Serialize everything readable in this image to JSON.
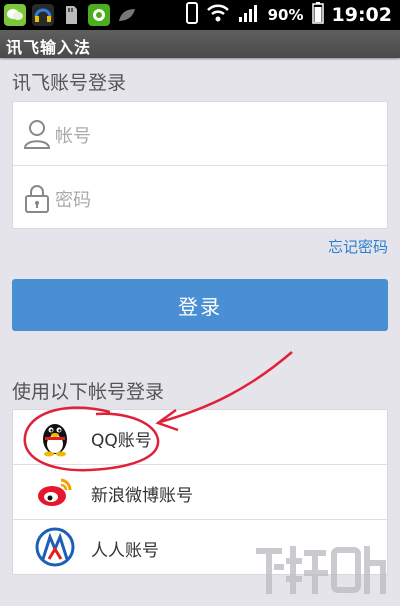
{
  "status_bar": {
    "battery_percent": "90%",
    "time": "19:02",
    "icons": [
      "wechat-icon",
      "headset-icon",
      "sd-card-icon",
      "wechat-green-icon",
      "leaf-icon",
      "phone-icon",
      "wifi-icon",
      "signal-icon",
      "battery-icon"
    ]
  },
  "app_title": "讯飞输入法",
  "login": {
    "section_title": "讯飞账号登录",
    "username_placeholder": "帐号",
    "password_placeholder": "密码",
    "forgot_password": "忘记密码",
    "login_button": "登录"
  },
  "third_party": {
    "section_title": "使用以下帐号登录",
    "options": [
      {
        "label": "QQ账号",
        "icon": "qq-penguin-icon"
      },
      {
        "label": "新浪微博账号",
        "icon": "weibo-icon"
      },
      {
        "label": "人人账号",
        "icon": "renren-icon"
      }
    ]
  },
  "colors": {
    "accent": "#4a8fd4",
    "link": "#2c7fd0",
    "annotation": "#e0213a",
    "background": "#e4e4ea"
  }
}
